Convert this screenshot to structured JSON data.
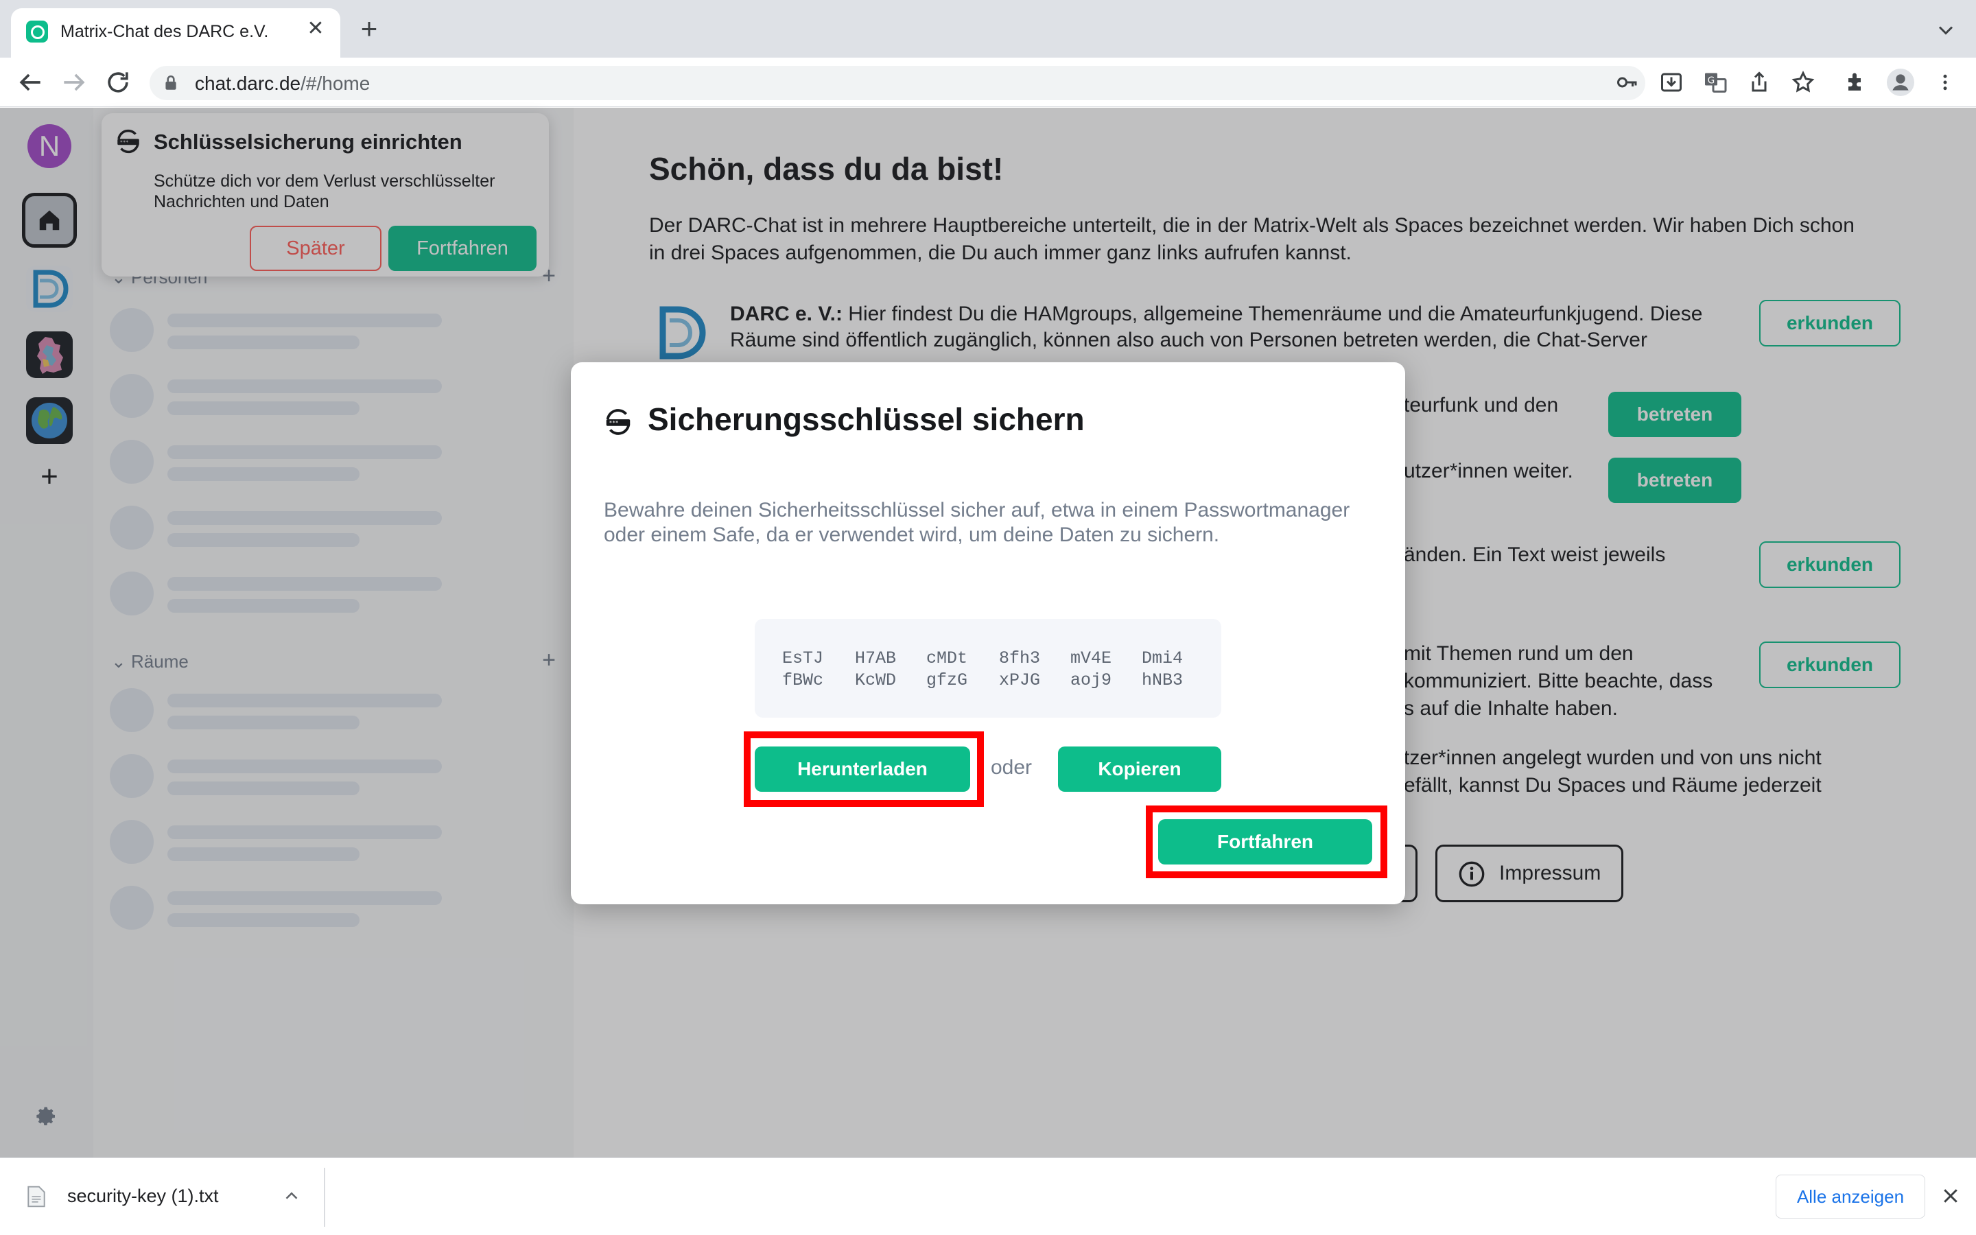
{
  "browser": {
    "tab_title": "Matrix-Chat des DARC e.V.",
    "url_host": "chat.darc.de",
    "url_path": "/#/home"
  },
  "spaces": {
    "avatar_letter": "N",
    "icons": [
      "home-icon",
      "darc-logo-icon",
      "germany-map-icon",
      "globe-icon",
      "plus-icon",
      "gear-icon"
    ]
  },
  "roomlist": {
    "people_label": "Personen",
    "rooms_label": "Räume"
  },
  "toast": {
    "title": "Schlüsselsicherung einrichten",
    "body": "Schütze dich vor dem Verlust verschlüsselter Nachrichten und Daten",
    "later": "Später",
    "continue": "Fortfahren"
  },
  "home": {
    "title": "Schön, dass du da bist!",
    "intro": "Der DARC-Chat ist in mehrere Hauptbereiche unterteilt, die in der Matrix-Welt als Spaces bezeichnet werden. Wir haben Dich schon in drei Spaces aufgenommen, die Du auch immer ganz links aufrufen kannst.",
    "darc_name": "DARC e. V.:",
    "darc_text": " Hier findest Du die HAMgroups, allgemeine Themenräume und die Amateurfunkjugend. Diese Räume sind öffentlich zugänglich, können also auch von Personen betreten werden, die Chat-Server anderer Anbieter nutzen. Für den Einstieg sind folgende Räume besonders interessant:",
    "frag1": "teurfunk und den",
    "frag2": "utzer*innen weiter.",
    "frag3": "änden. Ein Text weist jeweils",
    "frag4a": "mit Themen rund um den",
    "frag4b": "kommuniziert. Bitte beachte, dass",
    "frag4c": "s auf die Inhalte haben.",
    "frag5a": "tzer*innen angelegt wurden und von uns nicht",
    "frag5b": "efällt, kannst Du Spaces und Räume jederzeit",
    "explore": "erkunden",
    "join": "betreten",
    "impressum": "Impressum"
  },
  "dialog": {
    "title": "Sicherungsschlüssel sichern",
    "description": "Bewahre deinen Sicherheitsschlüssel sicher auf, etwa in einem Passwortmanager oder einem Safe, da er verwendet wird, um deine Daten zu sichern.",
    "key_row1": [
      "EsTJ",
      "H7AB",
      "cMDt",
      "8fh3",
      "mV4E",
      "Dmi4"
    ],
    "key_row2": [
      "fBWc",
      "KcWD",
      "gfzG",
      "xPJG",
      "aoj9",
      "hNB3"
    ],
    "download": "Herunterladen",
    "or": "oder",
    "copy": "Kopieren",
    "continue": "Fortfahren"
  },
  "downloads": {
    "file_name": "security-key (1).txt",
    "show_all": "Alle anzeigen"
  },
  "colors": {
    "accent": "#0dbd8b",
    "danger": "#ff5b55",
    "highlight": "#ff0000",
    "avatar": "#a24ac9"
  }
}
